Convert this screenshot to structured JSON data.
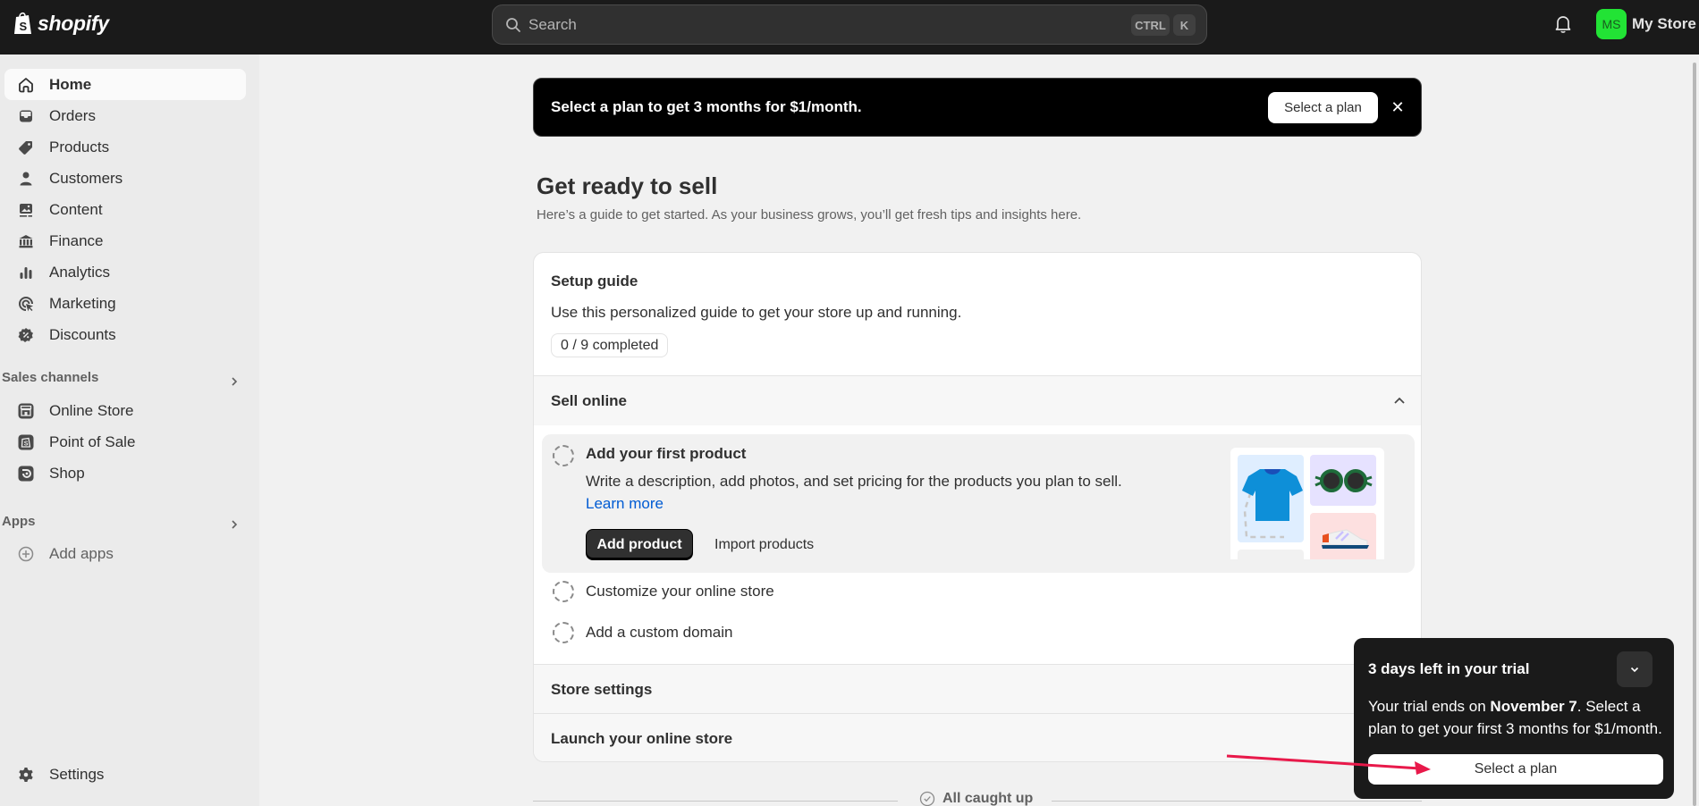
{
  "topbar": {
    "brand": "shopify",
    "search_placeholder": "Search",
    "shortcut_keys": [
      "CTRL",
      "K"
    ],
    "avatar_initials": "MS",
    "store_name": "My Store",
    "avatar_color": "#22e335"
  },
  "sidebar": {
    "items": [
      {
        "label": "Home",
        "icon": "home-icon",
        "active": true
      },
      {
        "label": "Orders",
        "icon": "inbox-icon"
      },
      {
        "label": "Products",
        "icon": "tag-icon"
      },
      {
        "label": "Customers",
        "icon": "person-icon"
      },
      {
        "label": "Content",
        "icon": "image-icon"
      },
      {
        "label": "Finance",
        "icon": "bank-icon"
      },
      {
        "label": "Analytics",
        "icon": "bar-chart-icon"
      },
      {
        "label": "Marketing",
        "icon": "target-cursor-icon"
      },
      {
        "label": "Discounts",
        "icon": "discount-badge-icon"
      }
    ],
    "sales_channels_label": "Sales channels",
    "sales_channels": [
      {
        "label": "Online Store",
        "icon": "storefront-icon"
      },
      {
        "label": "Point of Sale",
        "icon": "pos-bag-icon"
      },
      {
        "label": "Shop",
        "icon": "shop-app-icon"
      }
    ],
    "apps_label": "Apps",
    "add_apps_label": "Add apps",
    "settings_label": "Settings"
  },
  "promo_banner": {
    "text": "Select a plan to get 3 months for $1/month.",
    "button_label": "Select a plan",
    "close_symbol": "✕"
  },
  "main": {
    "title": "Get ready to sell",
    "subtitle": "Here’s a guide to get started. As your business grows, you’ll get fresh tips and insights here."
  },
  "setup_guide": {
    "title": "Setup guide",
    "description": "Use this personalized guide to get your store up and running.",
    "progress_text": "0 / 9 completed",
    "progress": {
      "completed": 0,
      "total": 9
    },
    "sections": [
      {
        "label": "Sell online",
        "expanded": true,
        "tasks": [
          {
            "title": "Add your first product",
            "description": "Write a description, add photos, and set pricing for the products you plan to sell.",
            "link": "Learn more",
            "primary_action": "Add product",
            "secondary_action": "Import products",
            "expanded": true
          },
          {
            "title": "Customize your online store"
          },
          {
            "title": "Add a custom domain"
          }
        ]
      },
      {
        "label": "Store settings",
        "expanded": false
      },
      {
        "label": "Launch your online store",
        "expanded": false
      }
    ]
  },
  "footer": {
    "caught_up_text": "All caught up"
  },
  "trial_popup": {
    "title": "3 days left in your trial",
    "body_prefix": "Your trial ends on ",
    "body_date": "November 7",
    "body_suffix": ". Select a plan to get your first 3 months for $1/month.",
    "button_label": "Select a plan"
  },
  "annotation": {
    "arrow_color": "#e8194a"
  }
}
